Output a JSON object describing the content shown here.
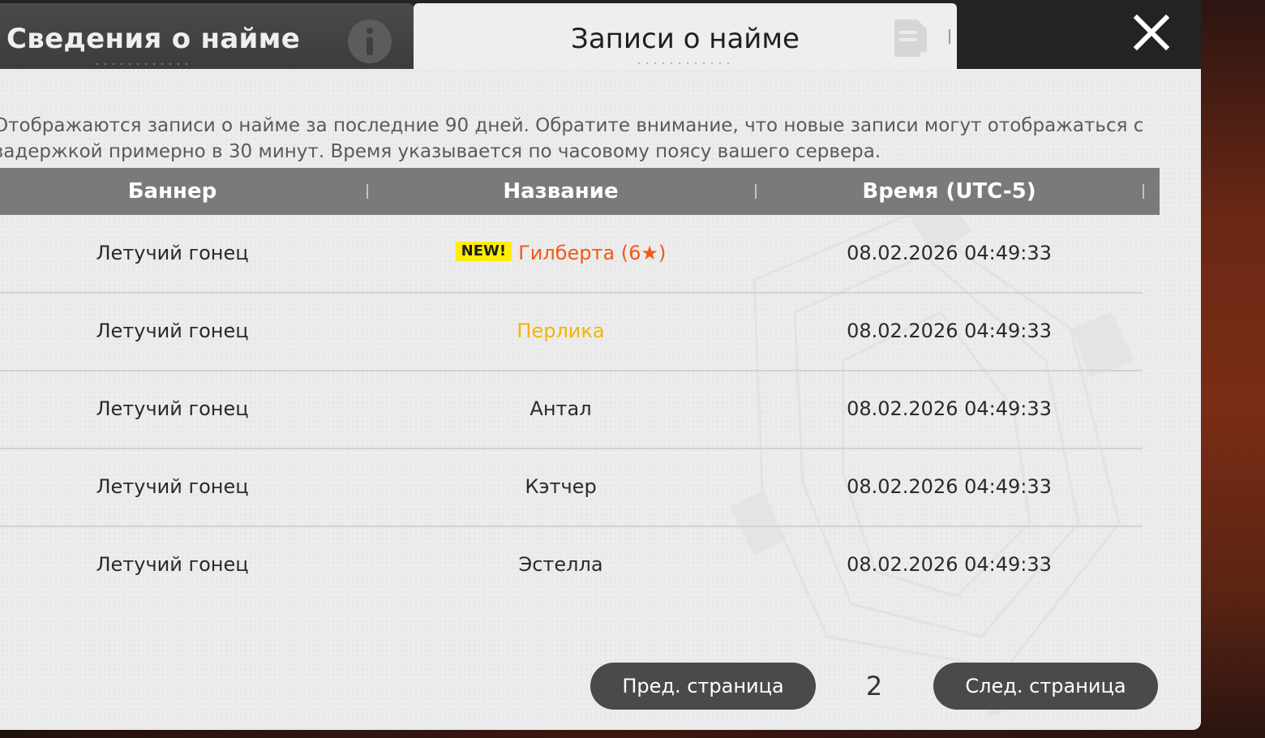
{
  "tabs": {
    "inactive": {
      "label": "Сведения о найме",
      "icon": "info-icon"
    },
    "active": {
      "label": "Записи о найме",
      "icon": "document-icon"
    }
  },
  "close": {
    "icon": "close-icon"
  },
  "notice": "Отображаются записи о найме за последние 90 дней. Обратите внимание, что новые записи могут отображаться с задержкой примерно в 30 минут. Время указывается по часовому поясу вашего сервера.",
  "table": {
    "columns": [
      "Баннер",
      "Название",
      "Время (UTC-5)"
    ],
    "rows": [
      {
        "banner": "Летучий гонец",
        "name": "Гилберта (6★)",
        "time": "08.02.2026 04:49:33",
        "badge": "NEW!",
        "color": "#f05a14"
      },
      {
        "banner": "Летучий гонец",
        "name": "Перлика",
        "time": "08.02.2026 04:49:33",
        "badge": "",
        "color": "#f4b400"
      },
      {
        "banner": "Летучий гонец",
        "name": "Антал",
        "time": "08.02.2026 04:49:33",
        "badge": "",
        "color": "#2a2a2a"
      },
      {
        "banner": "Летучий гонец",
        "name": "Кэтчер",
        "time": "08.02.2026 04:49:33",
        "badge": "",
        "color": "#2a2a2a"
      },
      {
        "banner": "Летучий гонец",
        "name": "Эстелла",
        "time": "08.02.2026 04:49:33",
        "badge": "",
        "color": "#2a2a2a"
      }
    ]
  },
  "pagination": {
    "prev_label": "Пред. страница",
    "page": "2",
    "next_label": "След. страница"
  },
  "colors": {
    "new_badge": "#ffee00",
    "six_star": "#f05a14",
    "five_star": "#f4b400",
    "header_bg": "#7a7a7a",
    "button_bg": "#4a4a4a"
  }
}
